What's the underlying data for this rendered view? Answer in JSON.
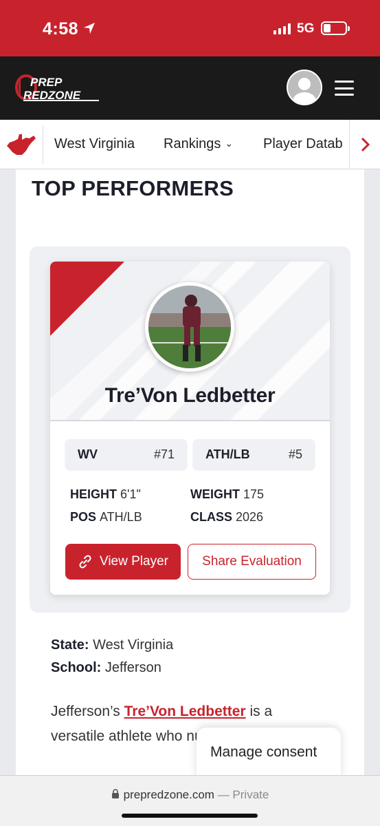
{
  "status_bar": {
    "time": "4:58",
    "network": "5G"
  },
  "header": {
    "logo_line1": "PREP",
    "logo_line2": "REDZONE"
  },
  "nav": {
    "items": [
      {
        "label": "West Virginia"
      },
      {
        "label": "Rankings"
      },
      {
        "label": "Player Datab"
      }
    ]
  },
  "page": {
    "title": "TOP PERFORMERS",
    "card": {
      "name": "Tre’Von Ledbetter",
      "chip1": {
        "label": "WV",
        "rank": "#71"
      },
      "chip2": {
        "label": "ATH/LB",
        "rank": "#5"
      },
      "stats": {
        "height_label": "HEIGHT",
        "height": "6'1\"",
        "weight_label": "WEIGHT",
        "weight": "175",
        "pos_label": "POS",
        "pos": "ATH/LB",
        "class_label": "CLASS",
        "class": "2026"
      },
      "view_button": "View Player",
      "share_button": "Share Evaluation"
    },
    "state_label": "State:",
    "state_value": "West Virginia",
    "school_label": "School:",
    "school_value": "Jefferson",
    "para_pre": "Jefferson’s ",
    "para_link": "Tre’Von Ledbetter",
    "para_post": " is a versatile athlete who numerous positions c"
  },
  "consent": {
    "label": "Manage consent"
  },
  "browser": {
    "domain": "prepredzone.com",
    "mode": "— Private"
  },
  "colors": {
    "brand_red": "#c8232c",
    "header_dark": "#1a1a1a"
  }
}
